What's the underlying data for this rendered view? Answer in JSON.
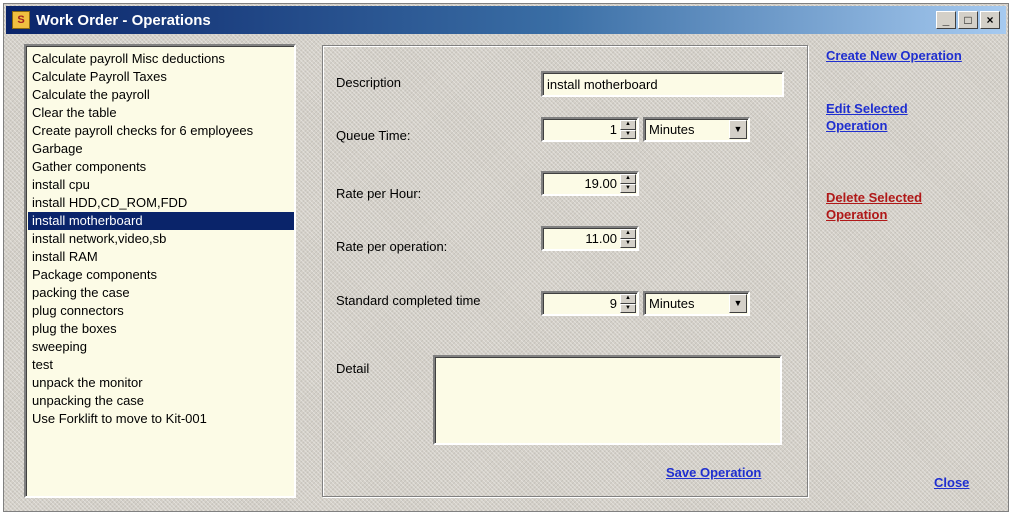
{
  "window": {
    "title": "Work Order - Operations",
    "controls": {
      "minimize": "_",
      "maximize": "□",
      "close": "×"
    }
  },
  "operations": {
    "items": [
      "Calculate payroll Misc deductions",
      "Calculate Payroll Taxes",
      "Calculate the payroll",
      "Clear the table",
      "Create payroll checks for 6 employees",
      "Garbage",
      "Gather components",
      "install cpu",
      "install HDD,CD_ROM,FDD",
      "install motherboard",
      "install network,video,sb",
      "install RAM",
      "Package components",
      "packing the case",
      "plug connectors",
      "plug the boxes",
      "sweeping",
      "test",
      "unpack the monitor",
      "unpacking the case",
      "Use Forklift to move to Kit-001"
    ],
    "selected": "install motherboard"
  },
  "form": {
    "description_label": "Description",
    "description_value": "install motherboard",
    "queue_time_label": "Queue Time:",
    "queue_time_value": "1",
    "queue_time_unit": "Minutes",
    "rate_hour_label": "Rate per Hour:",
    "rate_hour_value": "19.00",
    "rate_op_label": "Rate per operation:",
    "rate_op_value": "11.00",
    "std_time_label": "Standard completed time",
    "std_time_value": "9",
    "std_time_unit": "Minutes",
    "detail_label": "Detail",
    "detail_value": "",
    "save_link": "Save Operation"
  },
  "actions": {
    "create_new": "Create New Operation",
    "edit_selected_line1": "Edit Selected",
    "edit_selected_line2": "Operation",
    "delete_selected_line1": "Delete Selected",
    "delete_selected_line2": "Operation",
    "close": "Close"
  },
  "colors": {
    "title_gradient_start": "#0a246a",
    "selection": "#0a246a",
    "field_background": "#fcfbe6",
    "link_blue": "#1f2fd0",
    "link_red": "#b01818"
  },
  "icons": {
    "app": "app-icon",
    "spin": "spin-updown-icon",
    "dropdown": "chevron-down-icon"
  }
}
